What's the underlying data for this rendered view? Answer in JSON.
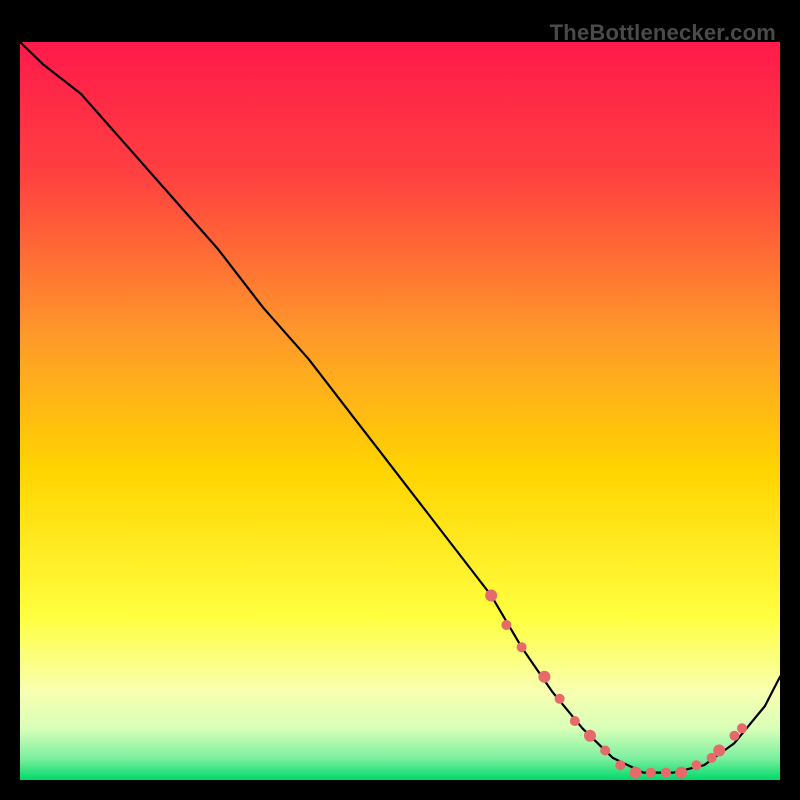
{
  "watermark": "TheBottlenecker.com",
  "colors": {
    "gradient_top": "#ff1a4b",
    "gradient_mid1": "#ff7a2a",
    "gradient_mid2": "#ffd400",
    "gradient_mid3": "#ffff66",
    "gradient_bottom_band": "#f6ffb0",
    "gradient_bottom": "#00e676",
    "curve": "#000000",
    "dot": "#e66a6a",
    "frame": "#000000"
  },
  "chart_data": {
    "type": "line",
    "title": "",
    "xlabel": "",
    "ylabel": "",
    "xlim": [
      0,
      100
    ],
    "ylim": [
      0,
      100
    ],
    "grid": false,
    "annotations": [
      "TheBottlenecker.com"
    ],
    "series": [
      {
        "name": "bottleneck-curve",
        "x": [
          0,
          3,
          8,
          14,
          20,
          26,
          32,
          38,
          44,
          50,
          56,
          62,
          66,
          70,
          74,
          78,
          82,
          86,
          90,
          94,
          98,
          100
        ],
        "y": [
          100,
          97,
          93,
          86,
          79,
          72,
          64,
          57,
          49,
          41,
          33,
          25,
          18,
          12,
          7,
          3,
          1,
          1,
          2,
          5,
          10,
          14
        ]
      }
    ],
    "highlight_dots": {
      "name": "trough-markers",
      "x": [
        62,
        64,
        66,
        69,
        71,
        73,
        75,
        77,
        79,
        81,
        83,
        85,
        87,
        89,
        91,
        92,
        94,
        95
      ],
      "y": [
        25,
        21,
        18,
        14,
        11,
        8,
        6,
        4,
        2,
        1,
        1,
        1,
        1,
        2,
        3,
        4,
        6,
        7
      ]
    }
  }
}
